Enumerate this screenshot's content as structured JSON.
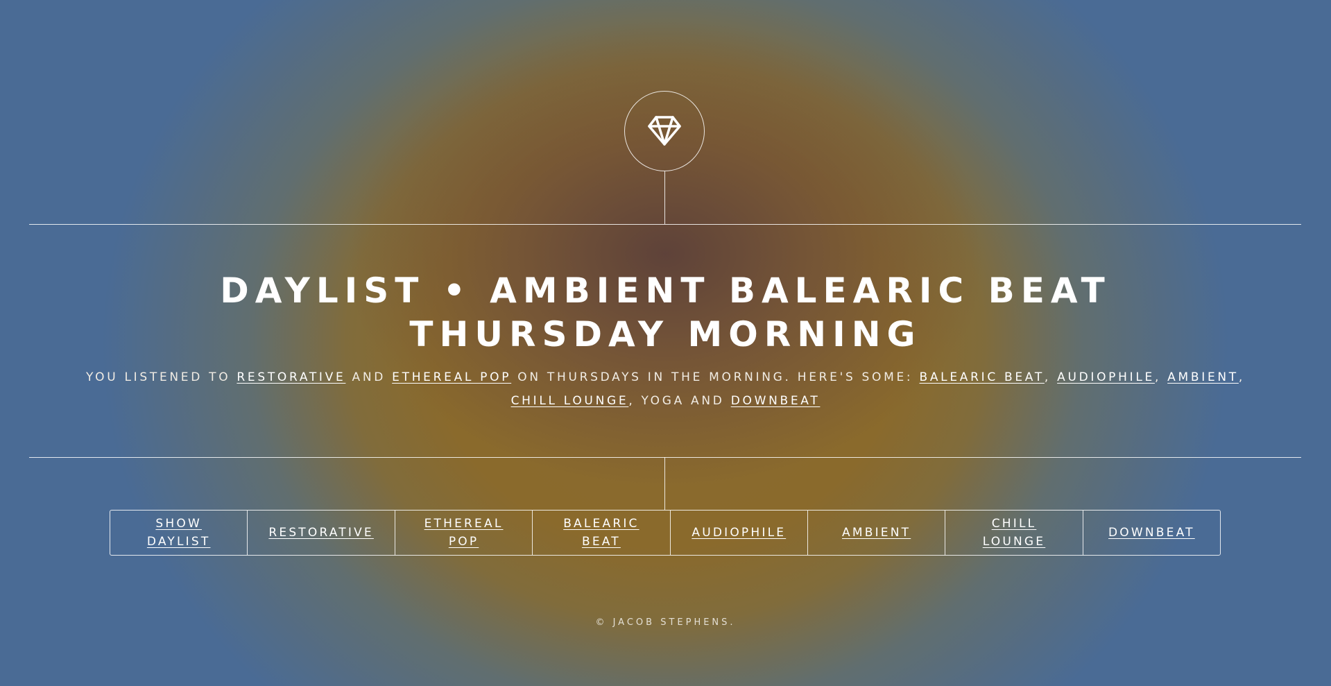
{
  "logo": {
    "icon": "diamond-icon"
  },
  "title": "Daylist • Ambient Balearic Beat Thursday Morning",
  "summary": {
    "intro": "You listened to ",
    "genre_1": "Restorative",
    "and_1": " and ",
    "genre_2": "Ethereal Pop",
    "middle": " on Thursdays in the morning. Here's some: ",
    "genre_3": "Balearic Beat",
    "comma_1": ", ",
    "genre_4": "Audiophile",
    "comma_2": ", ",
    "genre_5": "Ambient",
    "comma_3": ", ",
    "genre_6": "Chill Lounge",
    "yoga": ", yoga and ",
    "genre_7": "Downbeat"
  },
  "tags": [
    {
      "label": "Show Daylist"
    },
    {
      "label": "Restorative"
    },
    {
      "label": "Ethereal Pop"
    },
    {
      "label": "Balearic Beat"
    },
    {
      "label": "Audiophile"
    },
    {
      "label": "Ambient"
    },
    {
      "label": "Chill Lounge"
    },
    {
      "label": "Downbeat"
    }
  ],
  "footer": "© Jacob Stephens.",
  "colors": {
    "background_edge": "#4a6b95",
    "background_mid": "#8a6a2c",
    "background_center": "#5c403a",
    "text": "#ffffff"
  }
}
